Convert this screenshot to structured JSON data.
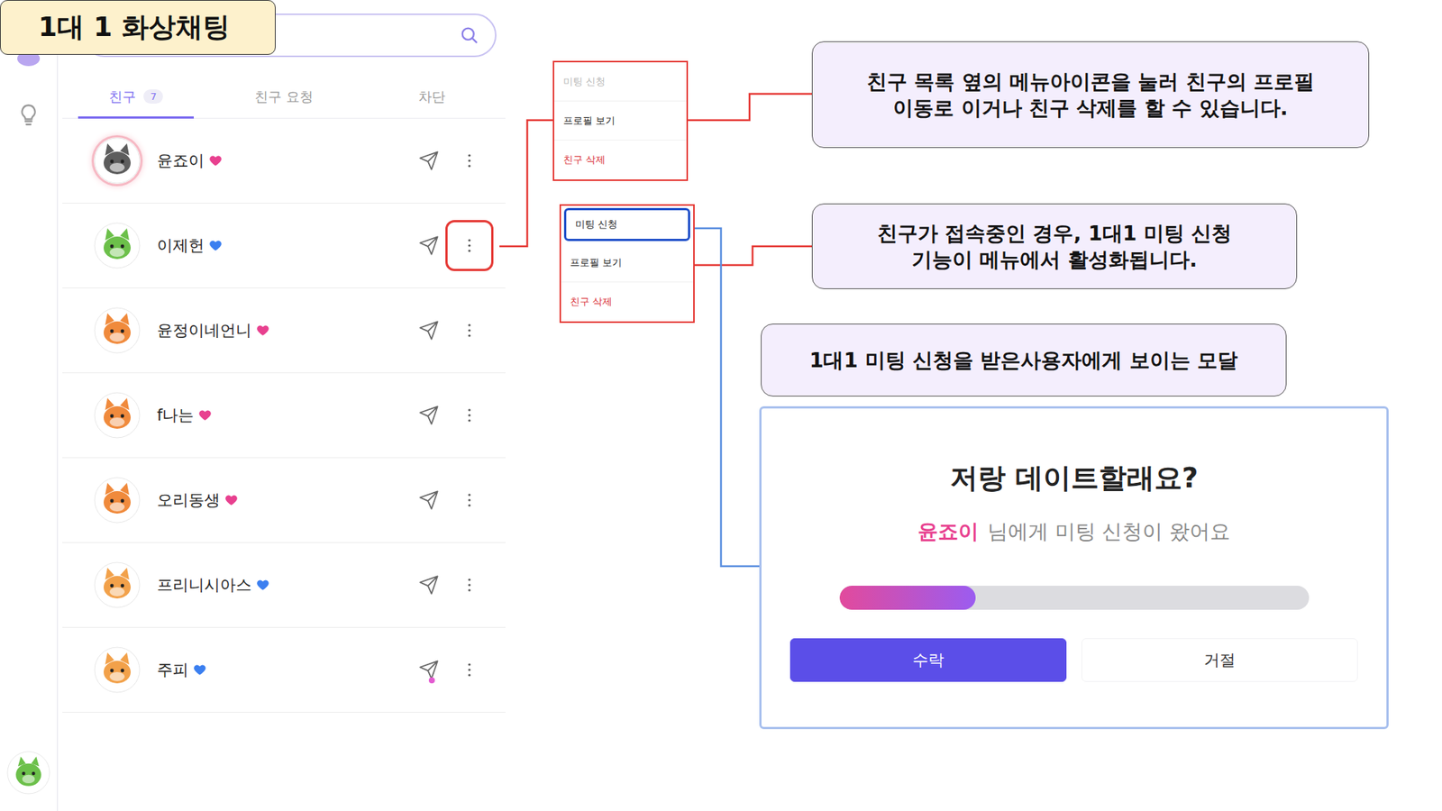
{
  "title": "1대 1 화상채팅",
  "me": {
    "avatar": "#6cc04a"
  },
  "tabs": [
    {
      "label": "친구",
      "count": "7",
      "selected": true
    },
    {
      "label": "친구 요청",
      "count": "",
      "selected": false
    },
    {
      "label": "차단",
      "count": "",
      "selected": false
    }
  ],
  "friends": [
    {
      "name": "윤죠이",
      "color": "#e8408f",
      "avatar": "#5d5d5d",
      "online": true,
      "highlighted": false,
      "unread": false
    },
    {
      "name": "이제헌",
      "color": "#3b7ff0",
      "avatar": "#6cc04a",
      "online": false,
      "highlighted": true,
      "unread": false
    },
    {
      "name": "윤정이네언니",
      "color": "#e8408f",
      "avatar": "#f08a3c",
      "online": false,
      "highlighted": false,
      "unread": false
    },
    {
      "name": "f나는",
      "color": "#e8408f",
      "avatar": "#f08a3c",
      "online": false,
      "highlighted": false,
      "unread": false
    },
    {
      "name": "오리동생",
      "color": "#e8408f",
      "avatar": "#f08a3c",
      "online": false,
      "highlighted": false,
      "unread": false
    },
    {
      "name": "프리니시아스",
      "color": "#3b7ff0",
      "avatar": "#f2a14a",
      "online": false,
      "highlighted": false,
      "unread": false
    },
    {
      "name": "주피",
      "color": "#3b7ff0",
      "avatar": "#f2a14a",
      "online": false,
      "highlighted": false,
      "unread": true
    }
  ],
  "menus": [
    {
      "items": [
        {
          "label": "미팅 신청",
          "disabled": true,
          "focused": false,
          "danger": false
        },
        {
          "label": "프로필 보기",
          "disabled": false,
          "focused": false,
          "danger": false
        },
        {
          "label": "친구 삭제",
          "disabled": false,
          "focused": false,
          "danger": true
        }
      ]
    },
    {
      "items": [
        {
          "label": "미팅 신청",
          "disabled": false,
          "focused": true,
          "danger": false
        },
        {
          "label": "프로필 보기",
          "disabled": false,
          "focused": false,
          "danger": false
        },
        {
          "label": "친구 삭제",
          "disabled": false,
          "focused": false,
          "danger": true
        }
      ]
    }
  ],
  "callouts": [
    {
      "lines": [
        "친구 목록 옆의 메뉴아이콘을 눌러 친구의 프로필",
        "이동로 이거나 친구 삭제를 할 수 있습니다."
      ]
    },
    {
      "lines": [
        "친구가 접속중인 경우, 1대1 미팅 신청",
        "기능이 메뉴에서 활성화됩니다."
      ]
    },
    {
      "lines": [
        "1대1 미팅 신청을 받은사용자에게 보이는 모달"
      ]
    }
  ],
  "modal": {
    "title": "저랑 데이트할래요?",
    "sender": "윤죠이",
    "message": "님에게 미팅 신청이 왔어요",
    "level": 0.29,
    "buttons": [
      {
        "label": "수락",
        "primary": true
      },
      {
        "label": "거절",
        "primary": false
      }
    ]
  }
}
